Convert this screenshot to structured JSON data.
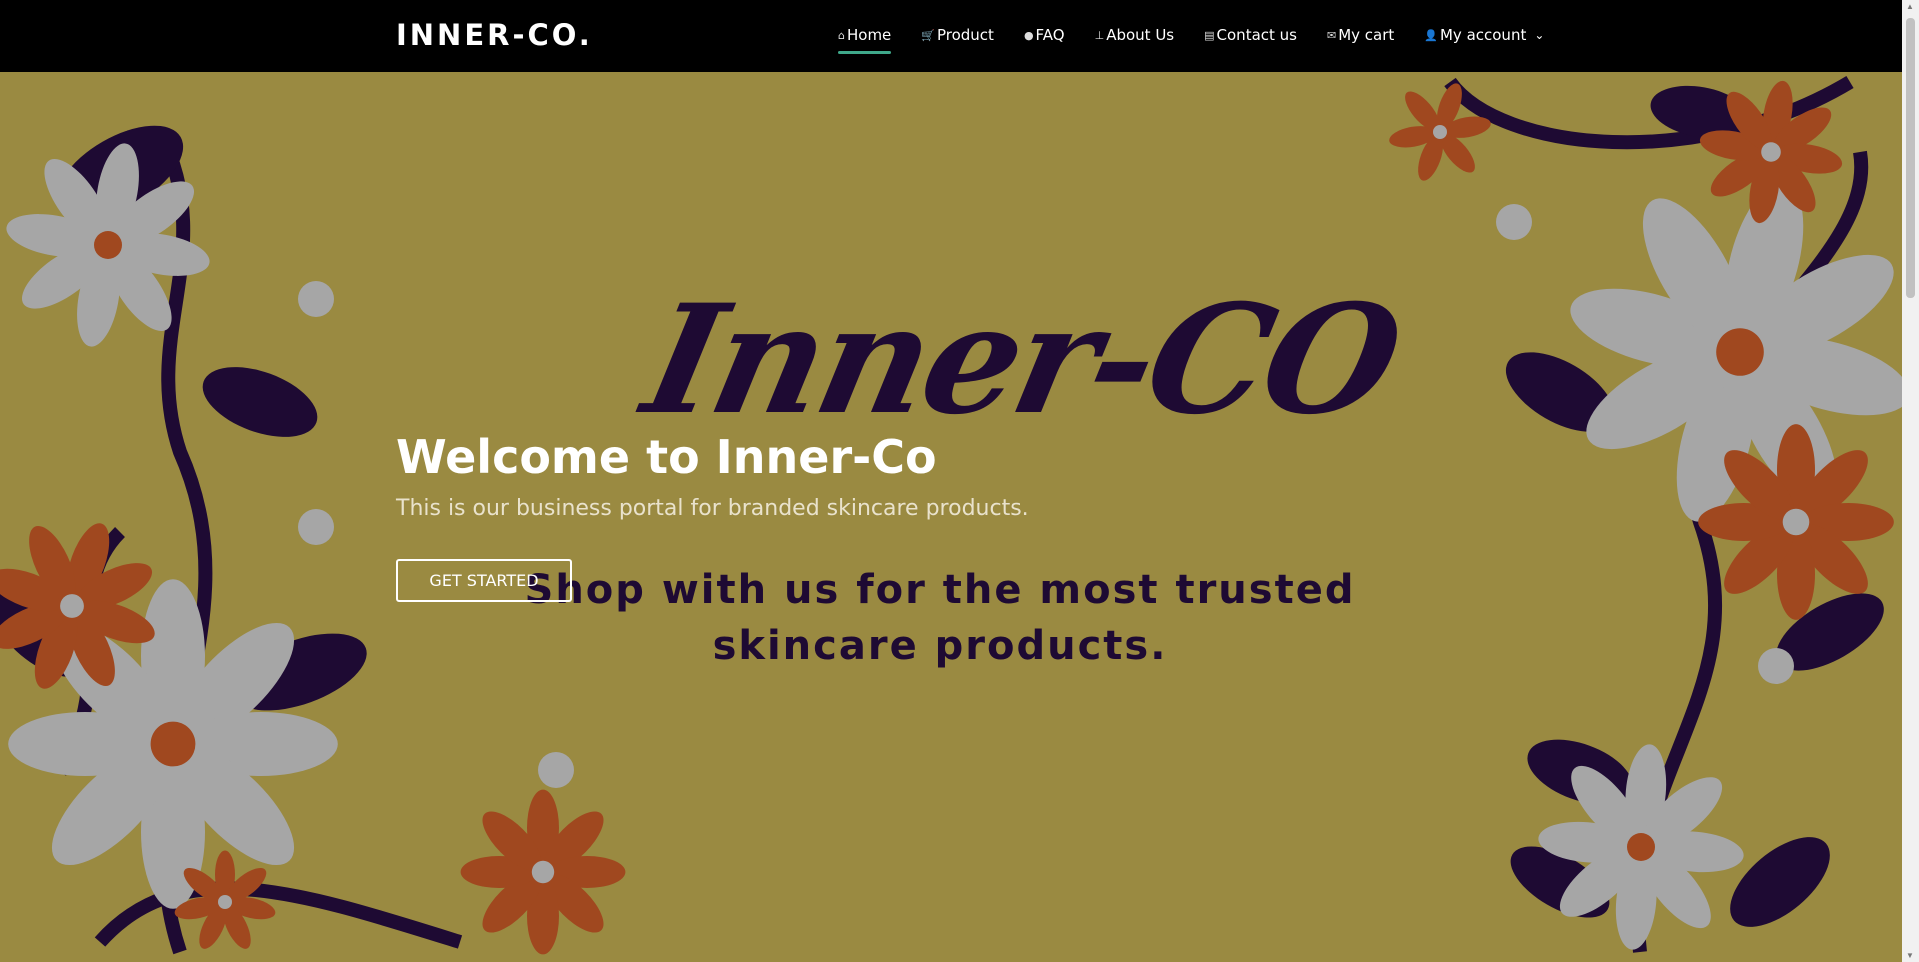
{
  "brand": "INNER-CO.",
  "nav": [
    {
      "icon": "home-icon",
      "glyph": "⌂",
      "label": "Home",
      "active": true
    },
    {
      "icon": "cart-icon",
      "glyph": "🛒",
      "label": "Product"
    },
    {
      "icon": "chat-icon",
      "glyph": "●",
      "label": "FAQ"
    },
    {
      "icon": "sitemap-icon",
      "glyph": "⊥",
      "label": "About Us"
    },
    {
      "icon": "contact-book-icon",
      "glyph": "▤",
      "label": "Contact us"
    },
    {
      "icon": "envelope-icon",
      "glyph": "✉",
      "label": "My cart"
    },
    {
      "icon": "user-icon",
      "glyph": "👤",
      "label": "My account",
      "dropdown": "⌄"
    }
  ],
  "hero": {
    "background_title": "Inner-CO",
    "background_tagline": "Shop with us for the most trusted skincare products.",
    "title": "Welcome to Inner-Co",
    "subtitle": "This is our business portal for branded skincare products.",
    "cta": "GET STARTED"
  },
  "colors": {
    "background": "#9a8a41",
    "purple": "#1e0a33",
    "petal": "#a6a6a6",
    "orange": "#a0481f",
    "accent": "#3fa88a"
  }
}
